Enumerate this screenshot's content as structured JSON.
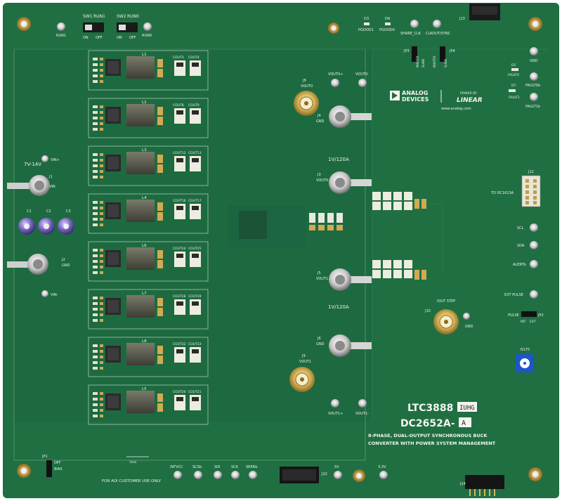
{
  "board": {
    "part_title": "LTC3888",
    "part_suffix": "IUHG",
    "board_name": "DC2652A-",
    "board_variant": "A",
    "description_line1": "8-PHASE, DUAL-OUTPUT SYNCHRONOUS BUCK",
    "description_line2": "CONVERTER WITH POWER SYSTEM MANAGEMENT",
    "customer_note": "FOR ADI CUSTOMER USE ONLY",
    "brand_line1": "ANALOG",
    "brand_line2": "DEVICES",
    "brand_powered": "POWER BY",
    "brand_linear": "LINEAR",
    "website": "www.analog.com",
    "colors": {
      "pcb": "#1f6f42",
      "pcb_dark": "#185c36",
      "silkscreen": "#f2f2ea",
      "gold": "#d9b45a",
      "copper": "#c8a14a",
      "potentiometer": "#1e56c8"
    }
  },
  "switches": {
    "sw1": "SW1",
    "sw1_top": "RUN1",
    "sw2": "SW2",
    "sw2_top": "RUN0",
    "on": "ON",
    "off": "OFF"
  },
  "top_labels": {
    "run1": "RUN1",
    "run0": "RUN0",
    "d3": "D3",
    "d4": "D4",
    "pgood1": "PGOOD1",
    "pgood0": "PGOOD0",
    "share_clk": "SHARE_CLK",
    "clkout_sync": "CLKOUT/SYNC",
    "j13": "J13",
    "jp3": "JP3",
    "jp4": "JP4",
    "master": "MASTER",
    "slave": "SLAVE"
  },
  "right_labels": {
    "gnd": "GND",
    "d2": "D2",
    "fault0": "FAULT0",
    "fault0b": "FAULT0b",
    "d7": "D7",
    "fault1": "FAULT1",
    "fault1b": "FAULT1b",
    "j12": "J12",
    "to_dc": "TO DC1613A",
    "scl": "SCL",
    "sda": "SDA",
    "alertb": "ALERTb",
    "exit_pulse": "EXT PULSE",
    "pulse": "PULSE",
    "jp2": "JP2",
    "int": "INT",
    "ext": "EXT",
    "r175": "R175"
  },
  "input": {
    "vin_plus": "VIN+",
    "vin_range": "7V-14V",
    "j1": "J1",
    "vin": "VIN",
    "c1": "C1",
    "c2": "C2",
    "c3": "C3",
    "j2": "J2",
    "gnd": "GND",
    "vin_minus": "VIN-"
  },
  "outputs": {
    "j8": "J8",
    "vout0": "VOUT0",
    "vout0_plus": "VOUT0+",
    "vout0_minus": "VOUT0-",
    "j4": "J4",
    "gnd": "GND",
    "rating0": "1V/120A",
    "j3": "J3",
    "j5": "J5",
    "vout1": "VOUT1",
    "rating1": "1V/120A",
    "j6": "J6",
    "j9": "J9",
    "vout1_plus": "VOUT1+",
    "vout1_minus": "VOUT1-",
    "j10": "J10",
    "iout_step": "IOUT STEP"
  },
  "phases": [
    {
      "ind": "L1",
      "cap_a": "COUT3",
      "cap_b": "COUT4"
    },
    {
      "ind": "L2",
      "cap_a": "COUT8",
      "cap_b": "COUT9"
    },
    {
      "ind": "L3",
      "cap_a": "COUT12",
      "cap_b": "COUT13"
    },
    {
      "ind": "L4",
      "cap_a": "COUT16",
      "cap_b": "COUT17"
    },
    {
      "ind": "L6",
      "cap_a": "COUT24",
      "cap_b": "COUT25"
    },
    {
      "ind": "L7",
      "cap_a": "COUT28",
      "cap_b": "COUT29"
    },
    {
      "ind": "L8",
      "cap_a": "COUT32",
      "cap_b": "COUT33"
    },
    {
      "ind": "L5",
      "cap_a": "COUT20",
      "cap_b": "COUT21"
    }
  ],
  "bottom_labels": {
    "jp1": "JP1",
    "off": "OFF",
    "bias": "BIAS",
    "intvcc": "INTVCC",
    "scsb": "SCSb",
    "sdi": "SDI",
    "sck": "SCK",
    "serrb": "SERRb",
    "j22": "J22",
    "v5": "5V",
    "v33": "3.3V",
    "j14": "J14",
    "ruler": "1mm"
  }
}
